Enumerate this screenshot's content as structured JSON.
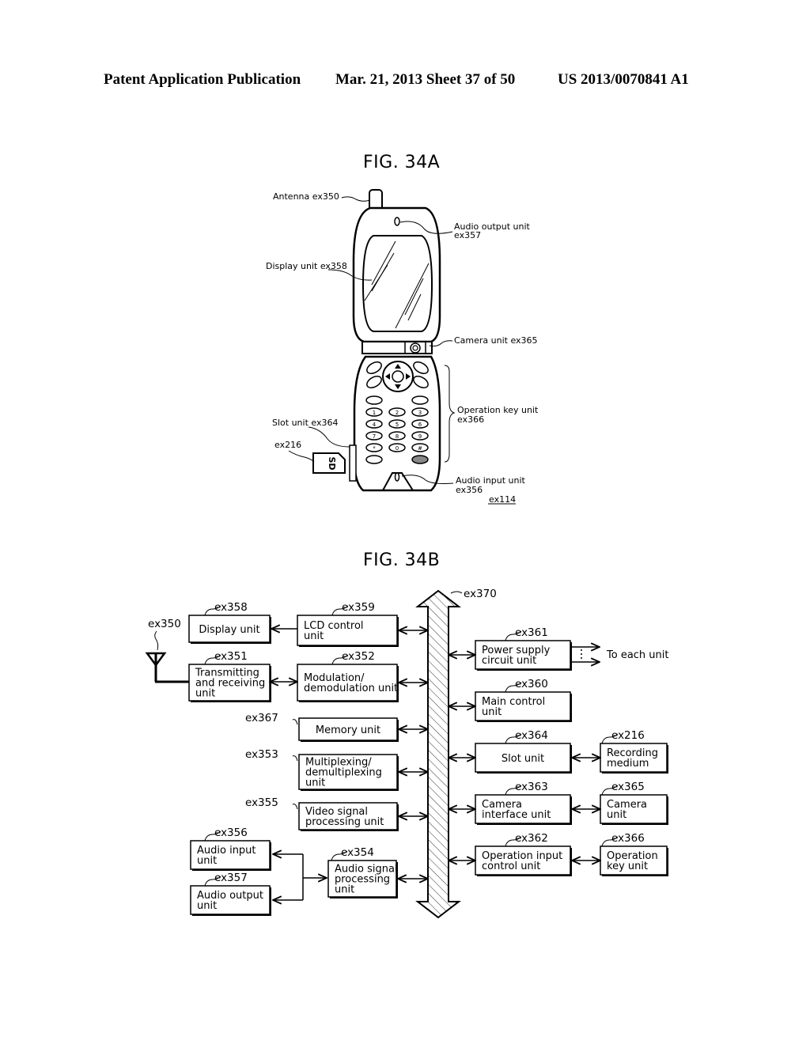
{
  "header": {
    "publication": "Patent Application Publication",
    "date_sheet": "Mar. 21, 2013  Sheet 37 of 50",
    "patent_number": "US 2013/0070841 A1"
  },
  "fig34a": {
    "title": "FIG. 34A",
    "labels": {
      "antenna": "Antenna ex350",
      "audio_output_1": "Audio output unit",
      "audio_output_2": "ex357",
      "display": "Display unit ex358",
      "camera": "Camera unit ex365",
      "operation_key_1": "Operation key unit",
      "operation_key_2": "ex366",
      "slot": "Slot unit ex364",
      "sd_ref": "ex216",
      "sd_text": "SD",
      "audio_input_1": "Audio input unit",
      "audio_input_2": "ex356",
      "phone_ref": "ex114"
    },
    "keys": [
      "1",
      "2",
      "3",
      "4",
      "5",
      "6",
      "7",
      "8",
      "9",
      "*",
      "0",
      "#"
    ]
  },
  "fig34b": {
    "title": "FIG. 34B",
    "bus_ref": "ex370",
    "antenna_ref": "ex350",
    "to_each_unit": "To each unit",
    "blocks": {
      "display": {
        "ref": "ex358",
        "l1": "Display unit",
        "l2": ""
      },
      "lcd": {
        "ref": "ex359",
        "l1": "LCD control",
        "l2": "unit"
      },
      "trx": {
        "ref": "ex351",
        "l1": "Transmitting",
        "l2": "and receiving",
        "l3": "unit"
      },
      "mod": {
        "ref": "ex352",
        "l1": "Modulation/",
        "l2": "demodulation unit"
      },
      "memory": {
        "ref": "ex367",
        "l1": "Memory unit"
      },
      "mux": {
        "ref": "ex353",
        "l1": "Multiplexing/",
        "l2": "demultiplexing",
        "l3": "unit"
      },
      "video": {
        "ref": "ex355",
        "l1": "Video signal",
        "l2": "processing unit"
      },
      "audio_in": {
        "ref": "ex356",
        "l1": "Audio input",
        "l2": "unit"
      },
      "audio_out": {
        "ref": "ex357",
        "l1": "Audio output",
        "l2": "unit"
      },
      "audio_sig": {
        "ref": "ex354",
        "l1": "Audio signal",
        "l2": "processing",
        "l3": "unit"
      },
      "power": {
        "ref": "ex361",
        "l1": "Power supply",
        "l2": "circuit unit"
      },
      "main": {
        "ref": "ex360",
        "l1": "Main control",
        "l2": "unit"
      },
      "slot": {
        "ref": "ex364",
        "l1": "Slot unit"
      },
      "recording": {
        "ref": "ex216",
        "l1": "Recording",
        "l2": "medium"
      },
      "cam_if": {
        "ref": "ex363",
        "l1": "Camera",
        "l2": "interface unit"
      },
      "camera": {
        "ref": "ex365",
        "l1": "Camera",
        "l2": "unit"
      },
      "op_input": {
        "ref": "ex362",
        "l1": "Operation input",
        "l2": "control unit"
      },
      "op_key": {
        "ref": "ex366",
        "l1": "Operation",
        "l2": "key unit"
      }
    }
  }
}
